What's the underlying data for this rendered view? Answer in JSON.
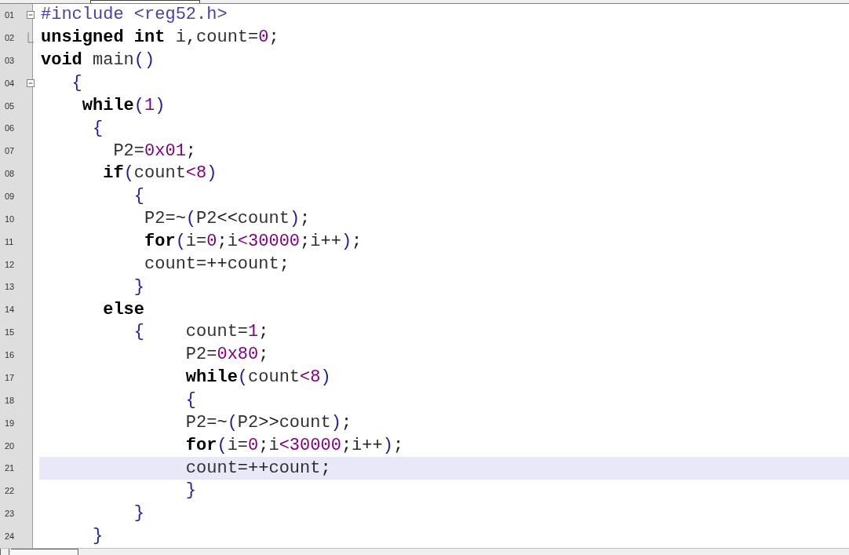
{
  "editor": {
    "lines": [
      {
        "number": "01",
        "kind": "foldstart",
        "selected": false,
        "tokens": [
          {
            "kind": "pre",
            "text": "#include <reg52.h>"
          }
        ]
      },
      {
        "number": "02",
        "kind": "foldend",
        "selected": false,
        "tokens": [
          {
            "kind": "kw",
            "text": "unsigned "
          },
          {
            "kind": "kw",
            "text": "int"
          },
          {
            "kind": "id",
            "text": " i"
          },
          {
            "kind": "op",
            "text": ","
          },
          {
            "kind": "id",
            "text": "count"
          },
          {
            "kind": "op",
            "text": "="
          },
          {
            "kind": "num",
            "text": "0"
          },
          {
            "kind": "op",
            "text": ";"
          }
        ]
      },
      {
        "number": "03",
        "kind": "plain",
        "selected": false,
        "tokens": [
          {
            "kind": "kw",
            "text": "void"
          },
          {
            "kind": "id",
            "text": " main"
          },
          {
            "kind": "punct",
            "text": "()"
          }
        ]
      },
      {
        "number": "04",
        "kind": "foldstart",
        "selected": false,
        "tokens": [
          {
            "kind": "punct",
            "text": "   {"
          }
        ]
      },
      {
        "number": "05",
        "kind": "plain",
        "selected": false,
        "tokens": [
          {
            "kind": "kw",
            "text": "    while"
          },
          {
            "kind": "punct",
            "text": "("
          },
          {
            "kind": "num",
            "text": "1"
          },
          {
            "kind": "punct",
            "text": ")"
          }
        ]
      },
      {
        "number": "06",
        "kind": "plain",
        "selected": false,
        "tokens": [
          {
            "kind": "punct",
            "text": "     {"
          }
        ]
      },
      {
        "number": "07",
        "kind": "plain",
        "selected": false,
        "tokens": [
          {
            "kind": "id",
            "text": "       P2"
          },
          {
            "kind": "op",
            "text": "="
          },
          {
            "kind": "num",
            "text": "0x01"
          },
          {
            "kind": "op",
            "text": ";"
          }
        ]
      },
      {
        "number": "08",
        "kind": "plain",
        "selected": false,
        "tokens": [
          {
            "kind": "kw",
            "text": "      if"
          },
          {
            "kind": "punct",
            "text": "("
          },
          {
            "kind": "id",
            "text": "count"
          },
          {
            "kind": "num",
            "text": "<8"
          },
          {
            "kind": "punct",
            "text": ")"
          }
        ]
      },
      {
        "number": "09",
        "kind": "plain",
        "selected": false,
        "tokens": [
          {
            "kind": "punct",
            "text": "         {"
          }
        ]
      },
      {
        "number": "10",
        "kind": "plain",
        "selected": false,
        "tokens": [
          {
            "kind": "id",
            "text": "          P2"
          },
          {
            "kind": "op",
            "text": "=~"
          },
          {
            "kind": "punct",
            "text": "("
          },
          {
            "kind": "id",
            "text": "P2"
          },
          {
            "kind": "op",
            "text": "<<"
          },
          {
            "kind": "id",
            "text": "count"
          },
          {
            "kind": "punct",
            "text": ")"
          },
          {
            "kind": "op",
            "text": ";"
          }
        ]
      },
      {
        "number": "11",
        "kind": "plain",
        "selected": false,
        "tokens": [
          {
            "kind": "kw",
            "text": "          for"
          },
          {
            "kind": "punct",
            "text": "("
          },
          {
            "kind": "id",
            "text": "i"
          },
          {
            "kind": "op",
            "text": "="
          },
          {
            "kind": "num",
            "text": "0"
          },
          {
            "kind": "op",
            "text": ";"
          },
          {
            "kind": "id",
            "text": "i"
          },
          {
            "kind": "num",
            "text": "<30000"
          },
          {
            "kind": "op",
            "text": ";"
          },
          {
            "kind": "id",
            "text": "i"
          },
          {
            "kind": "op",
            "text": "++"
          },
          {
            "kind": "punct",
            "text": ")"
          },
          {
            "kind": "op",
            "text": ";"
          }
        ]
      },
      {
        "number": "12",
        "kind": "plain",
        "selected": false,
        "tokens": [
          {
            "kind": "id",
            "text": "          count"
          },
          {
            "kind": "op",
            "text": "=++"
          },
          {
            "kind": "id",
            "text": "count"
          },
          {
            "kind": "op",
            "text": ";"
          }
        ]
      },
      {
        "number": "13",
        "kind": "plain",
        "selected": false,
        "tokens": [
          {
            "kind": "punct",
            "text": "         }"
          }
        ]
      },
      {
        "number": "14",
        "kind": "plain",
        "selected": false,
        "tokens": [
          {
            "kind": "kw",
            "text": "      else"
          }
        ]
      },
      {
        "number": "15",
        "kind": "plain",
        "selected": false,
        "tokens": [
          {
            "kind": "punct",
            "text": "         {"
          },
          {
            "kind": "id",
            "text": "    count"
          },
          {
            "kind": "op",
            "text": "="
          },
          {
            "kind": "num",
            "text": "1"
          },
          {
            "kind": "op",
            "text": ";"
          }
        ]
      },
      {
        "number": "16",
        "kind": "plain",
        "selected": false,
        "tokens": [
          {
            "kind": "id",
            "text": "              P2"
          },
          {
            "kind": "op",
            "text": "="
          },
          {
            "kind": "num",
            "text": "0x80"
          },
          {
            "kind": "op",
            "text": ";"
          }
        ]
      },
      {
        "number": "17",
        "kind": "plain",
        "selected": false,
        "tokens": [
          {
            "kind": "kw",
            "text": "              while"
          },
          {
            "kind": "punct",
            "text": "("
          },
          {
            "kind": "id",
            "text": "count"
          },
          {
            "kind": "num",
            "text": "<8"
          },
          {
            "kind": "punct",
            "text": ")"
          }
        ]
      },
      {
        "number": "18",
        "kind": "plain",
        "selected": false,
        "tokens": [
          {
            "kind": "punct",
            "text": "              {"
          }
        ]
      },
      {
        "number": "19",
        "kind": "plain",
        "selected": false,
        "tokens": [
          {
            "kind": "id",
            "text": "              P2"
          },
          {
            "kind": "op",
            "text": "=~"
          },
          {
            "kind": "punct",
            "text": "("
          },
          {
            "kind": "id",
            "text": "P2"
          },
          {
            "kind": "op",
            "text": ">>"
          },
          {
            "kind": "id",
            "text": "count"
          },
          {
            "kind": "punct",
            "text": ")"
          },
          {
            "kind": "op",
            "text": ";"
          }
        ]
      },
      {
        "number": "20",
        "kind": "plain",
        "selected": false,
        "tokens": [
          {
            "kind": "kw",
            "text": "              for"
          },
          {
            "kind": "punct",
            "text": "("
          },
          {
            "kind": "id",
            "text": "i"
          },
          {
            "kind": "op",
            "text": "="
          },
          {
            "kind": "num",
            "text": "0"
          },
          {
            "kind": "op",
            "text": ";"
          },
          {
            "kind": "id",
            "text": "i"
          },
          {
            "kind": "num",
            "text": "<30000"
          },
          {
            "kind": "op",
            "text": ";"
          },
          {
            "kind": "id",
            "text": "i"
          },
          {
            "kind": "op",
            "text": "++"
          },
          {
            "kind": "punct",
            "text": ")"
          },
          {
            "kind": "op",
            "text": ";"
          }
        ]
      },
      {
        "number": "21",
        "kind": "plain",
        "selected": true,
        "tokens": [
          {
            "kind": "id",
            "text": "              count"
          },
          {
            "kind": "op",
            "text": "=++"
          },
          {
            "kind": "id",
            "text": "count"
          },
          {
            "kind": "op",
            "text": ";"
          }
        ]
      },
      {
        "number": "22",
        "kind": "plain",
        "selected": false,
        "tokens": [
          {
            "kind": "punct",
            "text": "              }"
          }
        ]
      },
      {
        "number": "23",
        "kind": "plain",
        "selected": false,
        "tokens": [
          {
            "kind": "punct",
            "text": "         }"
          }
        ]
      },
      {
        "number": "24",
        "kind": "plain",
        "selected": false,
        "tokens": [
          {
            "kind": "punct",
            "text": "     }"
          }
        ]
      }
    ]
  }
}
